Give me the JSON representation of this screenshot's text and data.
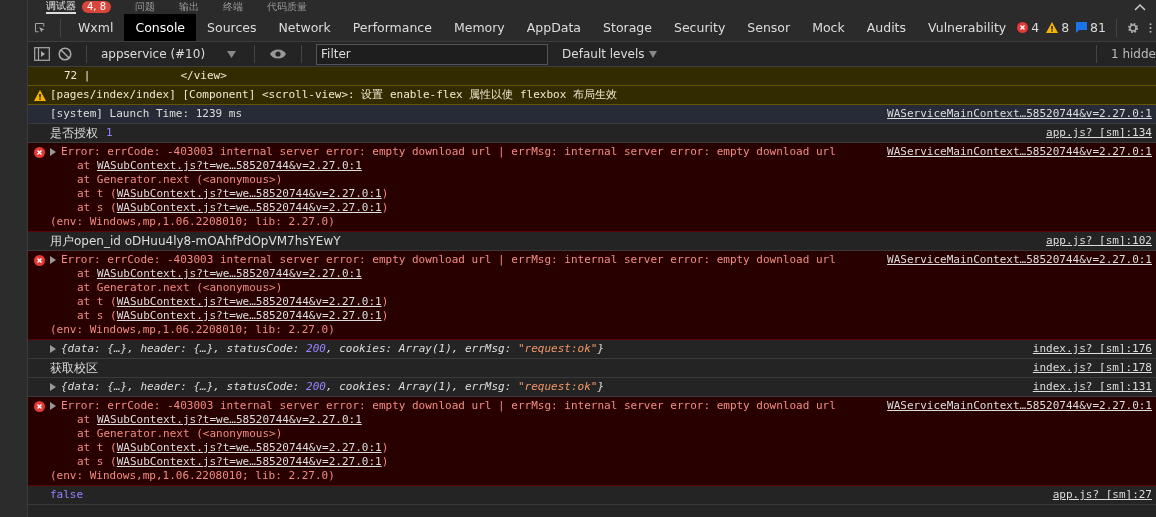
{
  "top_tabs": [
    {
      "label": "调试器",
      "badge": "4, 8",
      "selected": true
    },
    {
      "label": "问题",
      "selected": false
    },
    {
      "label": "输出",
      "selected": false
    },
    {
      "label": "终端",
      "selected": false
    },
    {
      "label": "代码质量",
      "selected": false
    }
  ],
  "tabs": [
    {
      "label": "Wxml",
      "selected": false
    },
    {
      "label": "Console",
      "selected": true
    },
    {
      "label": "Sources",
      "selected": false
    },
    {
      "label": "Network",
      "selected": false
    },
    {
      "label": "Performance",
      "selected": false
    },
    {
      "label": "Memory",
      "selected": false
    },
    {
      "label": "AppData",
      "selected": false
    },
    {
      "label": "Storage",
      "selected": false
    },
    {
      "label": "Security",
      "selected": false
    },
    {
      "label": "Sensor",
      "selected": false
    },
    {
      "label": "Mock",
      "selected": false
    },
    {
      "label": "Audits",
      "selected": false
    },
    {
      "label": "Vulnerability",
      "selected": false
    }
  ],
  "counts": {
    "errors": "4",
    "warnings": "8",
    "messages": "81"
  },
  "toolbar": {
    "context": "appservice (#10)",
    "filter_placeholder": "Filter",
    "levels": "Default levels",
    "hidden": "1 hidde"
  },
  "entries": [
    {
      "kind": "warning_tail",
      "line_no": "72 |",
      "text": "</view>"
    },
    {
      "kind": "warning",
      "text": "[pages/index/index] [Component] <scroll-view>: 设置 enable-flex 属性以使 flexbox 布局生效"
    },
    {
      "kind": "system",
      "text": "[system] Launch Time: 1239 ms",
      "source": "WAServiceMainContext…58520744&v=2.27.0:1"
    },
    {
      "kind": "log",
      "text": "是否授权",
      "value": "1",
      "source": "app.js? [sm]:134"
    },
    {
      "kind": "error",
      "message": "Error: errCode: -403003 internal server error: empty download url | errMsg: internal server error: empty download url",
      "stack": [
        {
          "before": "at ",
          "link": "WASubContext.js?t=we…58520744&v=2.27.0:1"
        },
        {
          "before": "at Generator.next (<anonymous>)"
        },
        {
          "before": "at t (",
          "link": "WASubContext.js?t=we…58520744&v=2.27.0:1",
          "after": ")"
        },
        {
          "before": "at s (",
          "link": "WASubContext.js?t=we…58520744&v=2.27.0:1",
          "after": ")"
        }
      ],
      "env": "(env: Windows,mp,1.06.2208010; lib: 2.27.0)",
      "source": "WAServiceMainContext…58520744&v=2.27.0:1"
    },
    {
      "kind": "log",
      "text": "用户open_id oDHuu4ly8-mOAhfPdOpVM7hsYEwY",
      "source": "app.js? [sm]:102"
    },
    {
      "kind": "error",
      "message": "Error: errCode: -403003 internal server error: empty download url | errMsg: internal server error: empty download url",
      "stack": [
        {
          "before": "at ",
          "link": "WASubContext.js?t=we…58520744&v=2.27.0:1"
        },
        {
          "before": "at Generator.next (<anonymous>)"
        },
        {
          "before": "at t (",
          "link": "WASubContext.js?t=we…58520744&v=2.27.0:1",
          "after": ")"
        },
        {
          "before": "at s (",
          "link": "WASubContext.js?t=we…58520744&v=2.27.0:1",
          "after": ")"
        }
      ],
      "env": "(env: Windows,mp,1.06.2208010; lib: 2.27.0)",
      "source": "WAServiceMainContext…58520744&v=2.27.0:1"
    },
    {
      "kind": "object",
      "parts": [
        {
          "text": "{data: {…}, header: {…}, statusCode: ",
          "kind": "plain"
        },
        {
          "text": "200",
          "kind": "number"
        },
        {
          "text": ", cookies: Array(1), errMsg: ",
          "kind": "plain"
        },
        {
          "text": "\"request:ok\"",
          "kind": "string"
        },
        {
          "text": "}",
          "kind": "plain"
        }
      ],
      "source": "index.js? [sm]:176"
    },
    {
      "kind": "log",
      "text": "获取校区",
      "source": "index.js? [sm]:178"
    },
    {
      "kind": "object",
      "parts": [
        {
          "text": "{data: {…}, header: {…}, statusCode: ",
          "kind": "plain"
        },
        {
          "text": "200",
          "kind": "number"
        },
        {
          "text": ", cookies: Array(1), errMsg: ",
          "kind": "plain"
        },
        {
          "text": "\"request:ok\"",
          "kind": "string"
        },
        {
          "text": "}",
          "kind": "plain"
        }
      ],
      "source": "index.js? [sm]:131"
    },
    {
      "kind": "error",
      "message": "Error: errCode: -403003 internal server error: empty download url | errMsg: internal server error: empty download url",
      "stack": [
        {
          "before": "at ",
          "link": "WASubContext.js?t=we…58520744&v=2.27.0:1"
        },
        {
          "before": "at Generator.next (<anonymous>)"
        },
        {
          "before": "at t (",
          "link": "WASubContext.js?t=we…58520744&v=2.27.0:1",
          "after": ")"
        },
        {
          "before": "at s (",
          "link": "WASubContext.js?t=we…58520744&v=2.27.0:1",
          "after": ")"
        }
      ],
      "env": "(env: Windows,mp,1.06.2208010; lib: 2.27.0)",
      "source": "WAServiceMainContext…58520744&v=2.27.0:1"
    },
    {
      "kind": "value",
      "value": "false",
      "source": "app.js? [sm]:27"
    }
  ]
}
